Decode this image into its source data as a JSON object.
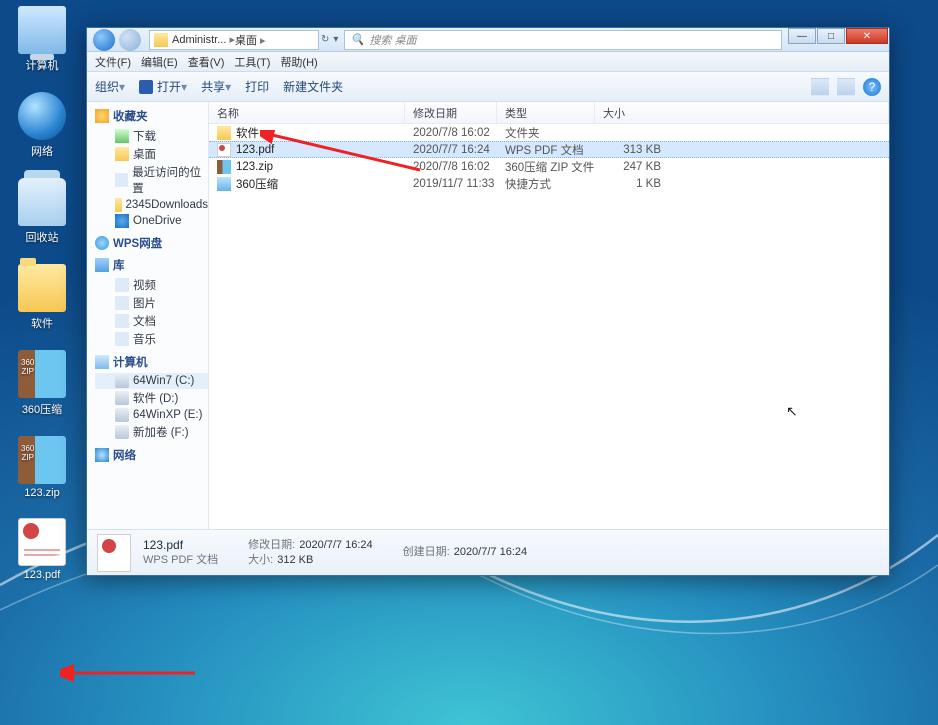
{
  "desktop_icons": [
    {
      "id": "computer",
      "label": "计算机",
      "icon": "computer"
    },
    {
      "id": "network",
      "label": "网络",
      "icon": "globe"
    },
    {
      "id": "recycle",
      "label": "回收站",
      "icon": "bin"
    },
    {
      "id": "software",
      "label": "软件",
      "icon": "folder"
    },
    {
      "id": "360zip",
      "label": "360压缩",
      "icon": "zipbook"
    },
    {
      "id": "123zip",
      "label": "123.zip",
      "icon": "zipbook"
    },
    {
      "id": "123pdf",
      "label": "123.pdf",
      "icon": "pdf"
    }
  ],
  "window": {
    "breadcrumb": [
      "Administr...",
      "桌面"
    ],
    "search_placeholder": "搜索 桌面",
    "menus": [
      "文件(F)",
      "编辑(E)",
      "查看(V)",
      "工具(T)",
      "帮助(H)"
    ],
    "toolbar": {
      "org": "组织",
      "open": "打开",
      "open_icon": "W",
      "share": "共享",
      "print": "打印",
      "newfolder": "新建文件夹"
    },
    "columns": {
      "name": "名称",
      "date": "修改日期",
      "type": "类型",
      "size": "大小"
    },
    "rows": [
      {
        "icon": "folder",
        "name": "软件",
        "date": "2020/7/8 16:02",
        "type": "文件夹",
        "size": "",
        "sel": false
      },
      {
        "icon": "pdf",
        "name": "123.pdf",
        "date": "2020/7/7 16:24",
        "type": "WPS PDF 文档",
        "size": "313 KB",
        "sel": true
      },
      {
        "icon": "zip",
        "name": "123.zip",
        "date": "2020/7/8 16:02",
        "type": "360压缩 ZIP 文件",
        "size": "247 KB",
        "sel": false
      },
      {
        "icon": "short",
        "name": "360压缩",
        "date": "2019/11/7 11:33",
        "type": "快捷方式",
        "size": "1 KB",
        "sel": false
      }
    ],
    "side": {
      "fav_hd": "收藏夹",
      "fav": [
        "下载",
        "桌面",
        "最近访问的位置",
        "2345Downloads",
        "OneDrive"
      ],
      "wps": "WPS网盘",
      "lib_hd": "库",
      "lib": [
        "视频",
        "图片",
        "文档",
        "音乐"
      ],
      "comp_hd": "计算机",
      "comp": [
        "64Win7 (C:)",
        "软件 (D:)",
        "64WinXP (E:)",
        "新加卷 (F:)"
      ],
      "net_hd": "网络"
    },
    "details": {
      "name": "123.pdf",
      "type": "WPS PDF 文档",
      "mdate_k": "修改日期:",
      "mdate_v": "2020/7/7 16:24",
      "size_k": "大小:",
      "size_v": "312 KB",
      "cdate_k": "创建日期:",
      "cdate_v": "2020/7/7 16:24"
    },
    "ctrl": {
      "min": "—",
      "max": "□",
      "close": "✕"
    }
  }
}
